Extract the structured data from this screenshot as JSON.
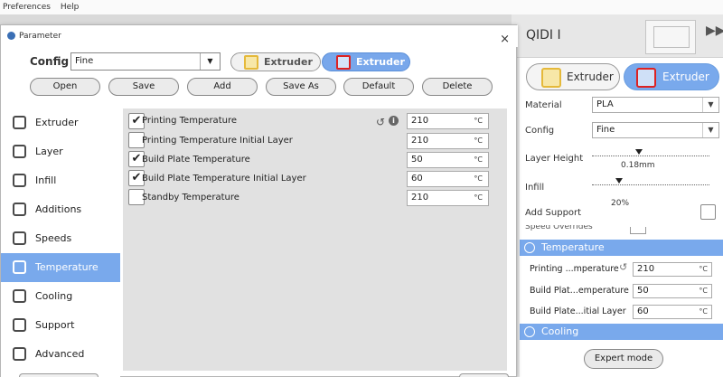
{
  "menubar": {
    "items": [
      "Preferences",
      "Help"
    ]
  },
  "dialog": {
    "title": "Parameter",
    "close": "×",
    "config_label": "Config",
    "config_value": "Fine",
    "extruders": [
      "Extruder",
      "Extruder"
    ],
    "actions": [
      "Open",
      "Save",
      "Add",
      "Save As",
      "Default",
      "Delete"
    ],
    "sidebar": [
      "Extruder",
      "Layer",
      "Infill",
      "Additions",
      "Speeds",
      "Temperature",
      "Cooling",
      "Support",
      "Advanced"
    ],
    "active_tab": "Temperature",
    "params": [
      {
        "label": "Printing Temperature",
        "checked": true,
        "value": "210",
        "unit": "°C"
      },
      {
        "label": "Printing Temperature Initial Layer",
        "checked": false,
        "value": "210",
        "unit": "°C"
      },
      {
        "label": "Build Plate Temperature",
        "checked": true,
        "value": "50",
        "unit": "°C"
      },
      {
        "label": "Build Plate Temperature Initial Layer",
        "checked": true,
        "value": "60",
        "unit": "°C"
      },
      {
        "label": "Standby Temperature",
        "checked": false,
        "value": "210",
        "unit": "°C"
      }
    ]
  },
  "panel": {
    "printer": "QIDI I",
    "extruders": [
      "Extruder",
      "Extruder"
    ],
    "material_label": "Material",
    "material_value": "PLA",
    "config_label": "Config",
    "config_value": "Fine",
    "layer_height_label": "Layer Height",
    "layer_height_value": "0.18mm",
    "infill_label": "Infill",
    "infill_value": "20%",
    "support_label": "Add Support",
    "clipped_text": "Speed Overrides",
    "temperature_header": "Temperature",
    "temps": [
      {
        "label": "Printing ...mperature",
        "value": "210",
        "unit": "°C"
      },
      {
        "label": "Build Plat...emperature",
        "value": "50",
        "unit": "°C"
      },
      {
        "label": "Build Plate...itial Layer",
        "value": "60",
        "unit": "°C"
      }
    ],
    "cooling_header": "Cooling",
    "expert_mode": "Expert mode"
  }
}
